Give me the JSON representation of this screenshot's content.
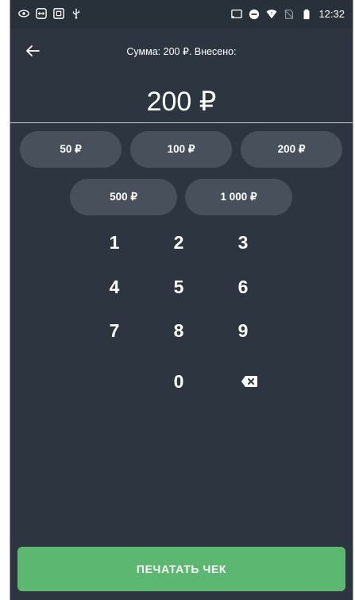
{
  "status_bar": {
    "time": "12:32",
    "left_icons": [
      "eye-icon",
      "teamviewer-icon",
      "screenshot-icon",
      "usb-icon"
    ],
    "right_icons": [
      "cast-icon",
      "do-not-disturb-icon",
      "wifi-icon",
      "no-sim-icon",
      "battery-icon"
    ]
  },
  "header": {
    "title": "Сумма: 200 ₽. Внесено:"
  },
  "amount": "200 ₽",
  "quick_amounts": [
    "50 ₽",
    "100 ₽",
    "200 ₽",
    "500 ₽",
    "1 000 ₽"
  ],
  "keypad": {
    "keys": [
      "1",
      "2",
      "3",
      "4",
      "5",
      "6",
      "7",
      "8",
      "9",
      "0"
    ],
    "backspace_icon": "backspace-icon"
  },
  "print_button": "ПЕЧАТАТЬ ЧЕК",
  "colors": {
    "background": "#2d3640",
    "chip": "#47505b",
    "accent": "#5cb871"
  }
}
